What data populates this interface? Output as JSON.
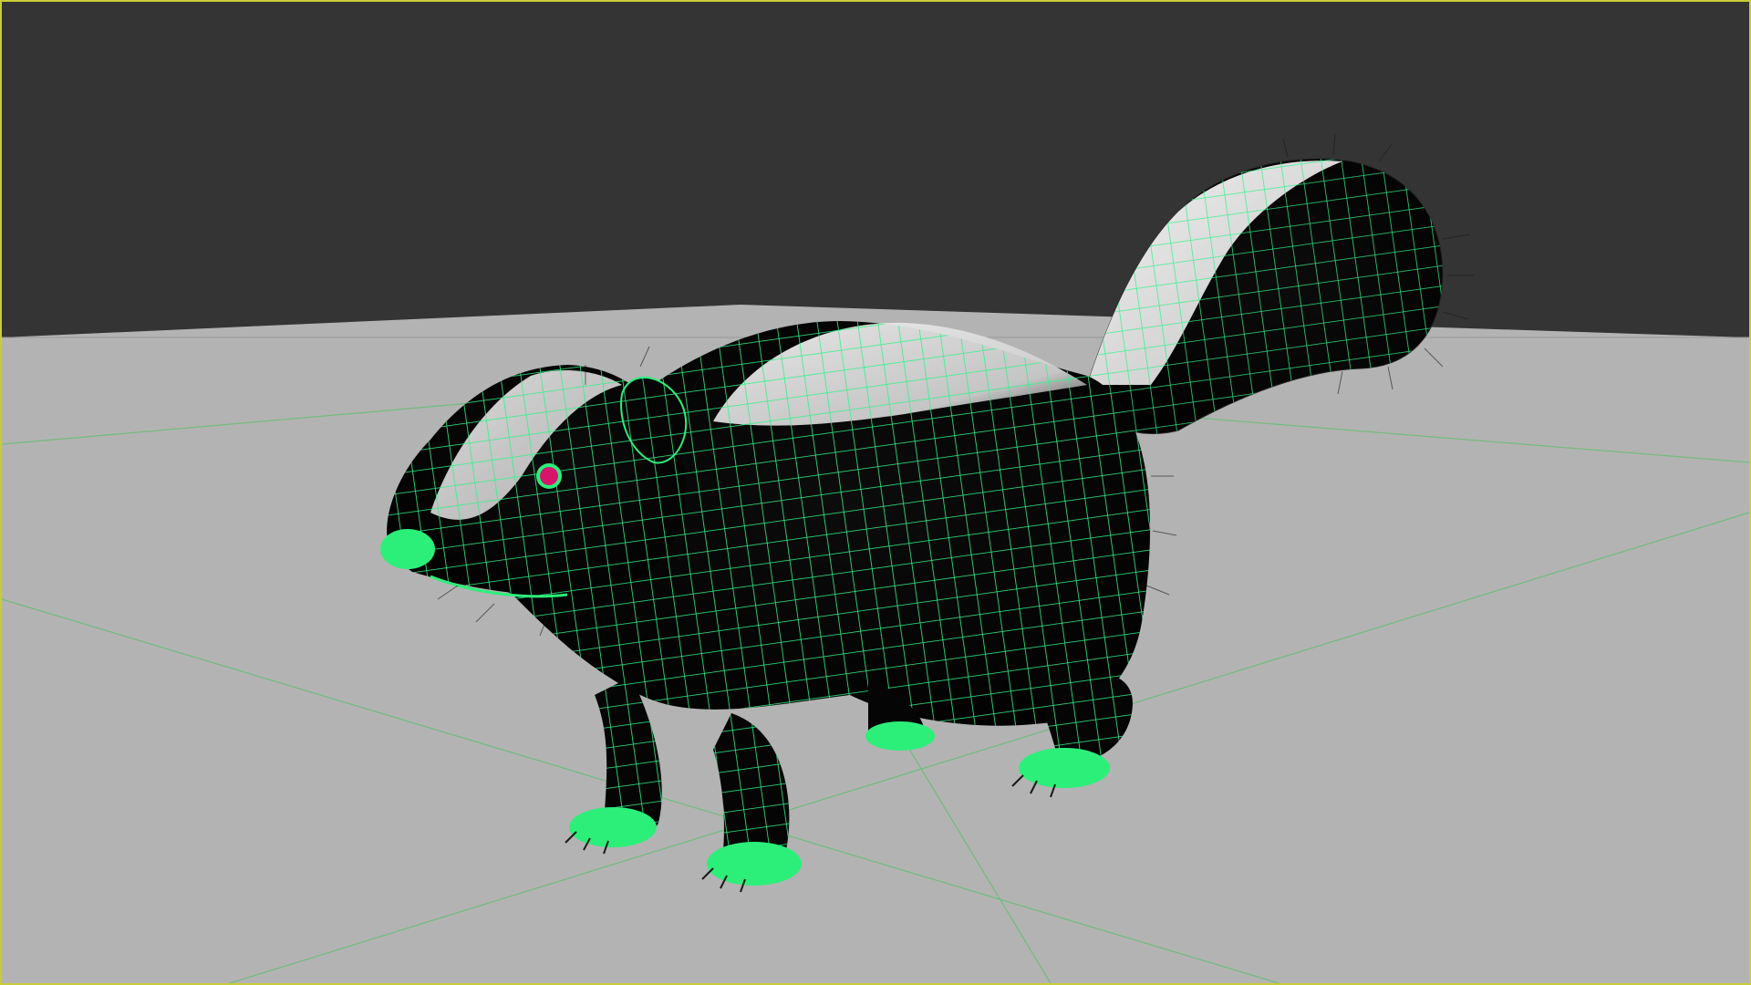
{
  "viewport": {
    "name": "3D viewport",
    "object": "skunk-mesh",
    "shading": "wireframe-on-shaded",
    "colors": {
      "background": "#343434",
      "border": "#c8cc3a",
      "ground": "#b3b3b3",
      "grid_line": "#5fbf6f",
      "wire": "#32f28a",
      "body": "#060606",
      "stripe": "#e6e6e6",
      "eye": "#d8146a",
      "fur": "#1a1a1a"
    }
  }
}
